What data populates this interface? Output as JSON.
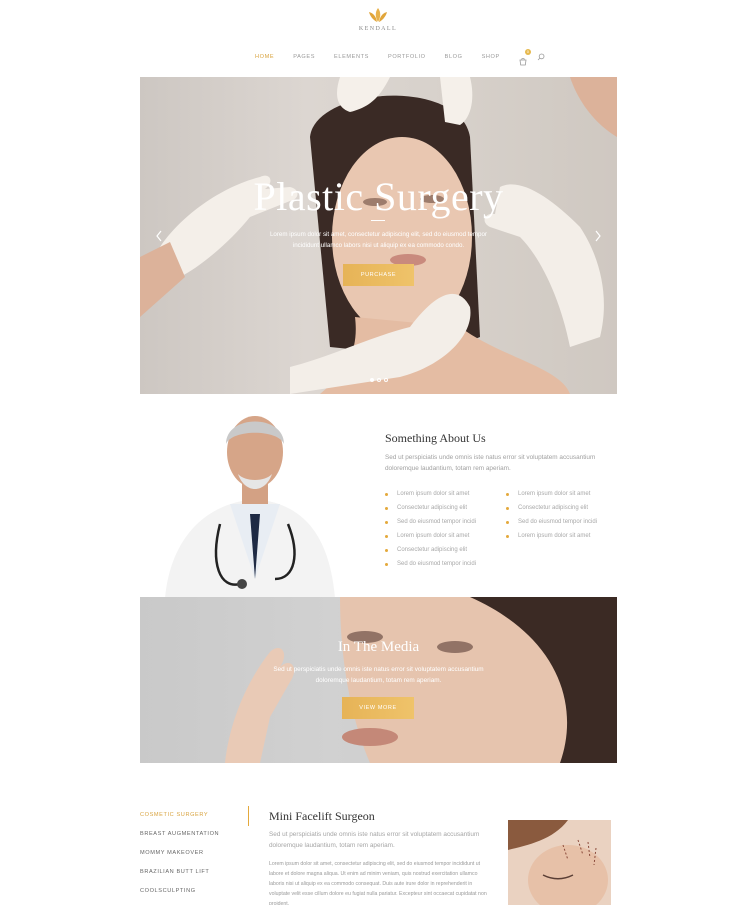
{
  "brand": {
    "name": "KENDALL",
    "logo_icon": "lotus-icon",
    "accent_color": "#e4a93c"
  },
  "nav": {
    "items": [
      "HOME",
      "PAGES",
      "ELEMENTS",
      "PORTFOLIO",
      "BLOG",
      "SHOP"
    ],
    "active": "HOME",
    "cart_count": "0"
  },
  "hero": {
    "title": "Plastic Surgery",
    "text": "Lorem ipsum dolor sit amet, consectetur adipiscing elit, sed do eiusmod tempor incididunt ullamco labors nisi ut aliquip ex ea commodo condo.",
    "button": "PURCHASE",
    "slide_count": 3,
    "active_slide": 1
  },
  "about": {
    "title": "Something About Us",
    "text": "Sed ut perspiciatis unde omnis iste natus error sit voluptatem accusantium doloremque laudantium, totam rem aperiam.",
    "list_left": [
      "Lorem ipsum dolor sit amet",
      "Consectetur adipiscing elit",
      "Sed do eiusmod tempor incidi",
      "Lorem ipsum dolor sit amet",
      "Consectetur adipiscing elit",
      "Sed do eiusmod tempor incidi"
    ],
    "list_right": [
      "Lorem ipsum dolor sit amet",
      "Consectetur adipiscing elit",
      "Sed do eiusmod tempor incidi",
      "Lorem ipsum dolor sit amet"
    ]
  },
  "media": {
    "title": "In The Media",
    "text": "Sed ut perspiciatis unde omnis iste natus error sit voluptatem accusantium doloremque laudantium, totam rem aperiam.",
    "button": "VIEW MORE"
  },
  "services": {
    "tabs": [
      "COSMETIC SURGERY",
      "BREAST AUGMENTATION",
      "MOMMY MAKEOVER",
      "BRAZILIAN BUTT LIFT",
      "COOLSCULPTING"
    ],
    "active_tab": "COSMETIC SURGERY",
    "title": "Mini Facelift Surgeon",
    "text": "Sed ut perspiciatis unde omnis iste natus error sit voluptatem accusantium doloremque laudantium, totam rem aperiam.",
    "body": "Lorem ipsum dolor sit amet, consectetur adipiscing elit, sed do eiusmod tempor incididunt ut labore et dolore magna aliqua. Ut enim ad minim veniam, quis nostrud exercitation ullamco laboris nisi ut aliquip ex ea commodo consequat. Duis aute irure dolor in reprehenderit in voluptate velit esse cillum dolore eu fugiat nulla pariatur. Excepteur sint occaecat cupidatat non proident."
  }
}
